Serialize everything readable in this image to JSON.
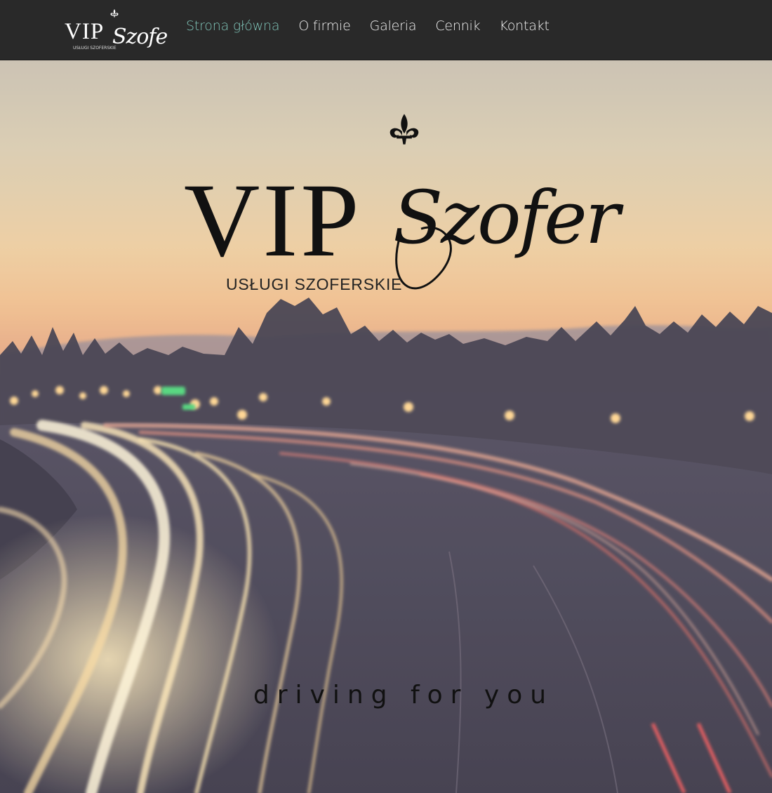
{
  "nav": {
    "logo": {
      "main": "VIP",
      "script": "Szofer",
      "subtitle": "USŁUGI SZOFERSKIE"
    },
    "items": [
      {
        "label": "Strona główna",
        "active": true
      },
      {
        "label": "O firmie",
        "active": false
      },
      {
        "label": "Galeria",
        "active": false
      },
      {
        "label": "Cennik",
        "active": false
      },
      {
        "label": "Kontakt",
        "active": false
      }
    ],
    "active_color": "#7fc4b8"
  },
  "hero": {
    "logo": {
      "main": "VIP",
      "script": "Szofer",
      "subtitle": "USŁUGI SZOFERSKIE"
    },
    "tagline": "driving for you",
    "background": "highway-light-trails-sunset"
  }
}
